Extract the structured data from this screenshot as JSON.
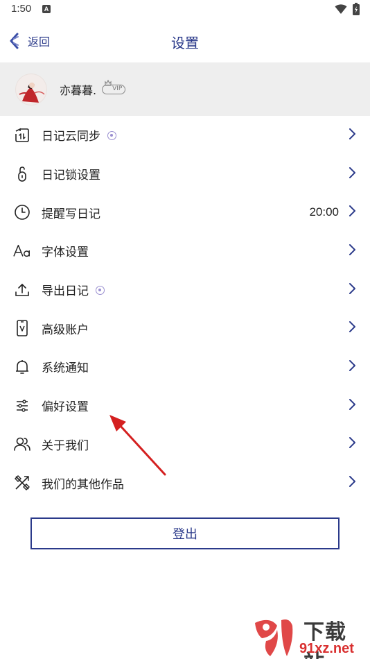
{
  "status_bar": {
    "time": "1:50",
    "notification_glyph": "A"
  },
  "nav": {
    "back_label": "返回",
    "title": "设置"
  },
  "profile": {
    "username": "亦暮暮.",
    "vip_label": "VIP"
  },
  "menu": {
    "items": [
      {
        "label": "日记云同步",
        "icon": "cloud-sync-icon",
        "has_dot": true,
        "value": ""
      },
      {
        "label": "日记锁设置",
        "icon": "lock-icon",
        "has_dot": false,
        "value": ""
      },
      {
        "label": "提醒写日记",
        "icon": "clock-icon",
        "has_dot": false,
        "value": "20:00"
      },
      {
        "label": "字体设置",
        "icon": "font-icon",
        "has_dot": false,
        "value": ""
      },
      {
        "label": "导出日记",
        "icon": "export-icon",
        "has_dot": true,
        "value": ""
      },
      {
        "label": "高级账户",
        "icon": "premium-account-icon",
        "has_dot": false,
        "value": ""
      },
      {
        "label": "系统通知",
        "icon": "bell-icon",
        "has_dot": false,
        "value": ""
      },
      {
        "label": "偏好设置",
        "icon": "sliders-icon",
        "has_dot": false,
        "value": ""
      },
      {
        "label": "关于我们",
        "icon": "users-icon",
        "has_dot": false,
        "value": ""
      },
      {
        "label": "我们的其他作品",
        "icon": "tools-icon",
        "has_dot": false,
        "value": ""
      }
    ]
  },
  "logout": {
    "label": "登出"
  },
  "watermark": {
    "top": "下载站",
    "bottom": "91xz.net"
  },
  "colors": {
    "accent": "#2b3a8a",
    "profile_bg": "#eeeeee",
    "dot": "#9a8fd0",
    "annotation": "#d42020"
  }
}
